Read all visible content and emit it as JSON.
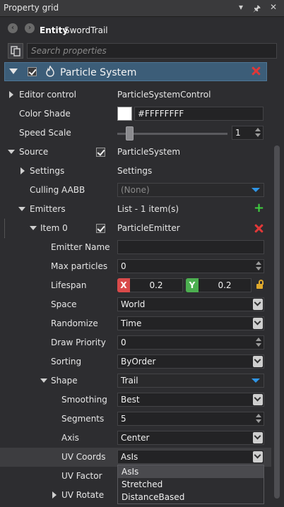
{
  "panel": {
    "title": "Property grid"
  },
  "entity": {
    "label": "Entity",
    "name": "SwordTrail"
  },
  "search": {
    "placeholder": "Search properties"
  },
  "component": {
    "name": "Particle System"
  },
  "rows": {
    "editor_control": {
      "label": "Editor control",
      "value": "ParticleSystemControl"
    },
    "color_shade": {
      "label": "Color Shade",
      "value": "#FFFFFFFF",
      "swatch_color": "#FFFFFF"
    },
    "speed_scale": {
      "label": "Speed Scale",
      "value": "1",
      "slider_fraction": 0.08
    },
    "source": {
      "label": "Source",
      "value": "ParticleSystem"
    },
    "settings": {
      "label": "Settings",
      "value": "Settings"
    },
    "culling_aabb": {
      "label": "Culling AABB",
      "value": "(None)"
    },
    "emitters": {
      "label": "Emitters",
      "value": "List - 1 item(s)"
    },
    "item0": {
      "label": "Item 0",
      "value": "ParticleEmitter"
    },
    "emitter_name": {
      "label": "Emitter Name",
      "value": ""
    },
    "max_particles": {
      "label": "Max particles",
      "value": "0"
    },
    "lifespan": {
      "label": "Lifespan",
      "x_tag": "X",
      "x_value": "0.2",
      "y_tag": "Y",
      "y_value": "0.2"
    },
    "space": {
      "label": "Space",
      "value": "World"
    },
    "randomize": {
      "label": "Randomize",
      "value": "Time"
    },
    "draw_priority": {
      "label": "Draw Priority",
      "value": "0"
    },
    "sorting": {
      "label": "Sorting",
      "value": "ByOrder"
    },
    "shape": {
      "label": "Shape",
      "value": "Trail"
    },
    "smoothing": {
      "label": "Smoothing",
      "value": "Best"
    },
    "segments": {
      "label": "Segments",
      "value": "5"
    },
    "axis": {
      "label": "Axis",
      "value": "Center"
    },
    "uv_coords": {
      "label": "UV Coords",
      "value": "AsIs"
    },
    "uv_factor": {
      "label": "UV Factor"
    },
    "uv_rotate": {
      "label": "UV Rotate"
    }
  },
  "uv_dropdown": {
    "options": [
      "AsIs",
      "Stretched",
      "DistanceBased"
    ],
    "selected": "AsIs"
  },
  "colors": {
    "header_bg": "#3C5D78",
    "accent_blue": "#2F95E6",
    "x_red": "#D94A4A",
    "y_green": "#4CAF50",
    "delete_red": "#E03838",
    "add_green": "#3FCF3F"
  }
}
